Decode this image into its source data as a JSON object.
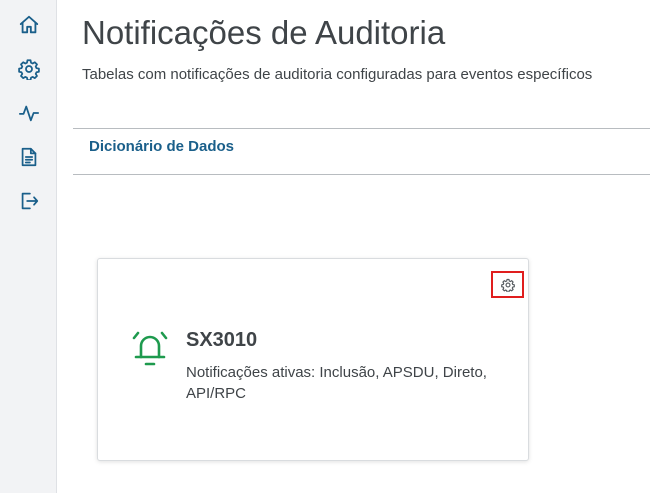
{
  "sidebar": {
    "items": [
      {
        "icon": "home-icon"
      },
      {
        "icon": "gear-icon"
      },
      {
        "icon": "activity-icon"
      },
      {
        "icon": "document-icon"
      },
      {
        "icon": "logout-icon"
      }
    ],
    "icon_color": "#1a5f8a"
  },
  "header": {
    "title": "Notificações de Auditoria",
    "subtitle": "Tabelas com notificações de auditoria configuradas para eventos específicos"
  },
  "tabs": [
    {
      "label": "Dicionário de Dados"
    }
  ],
  "cards": [
    {
      "title": "SX3010",
      "description": "Notificações ativas: Inclusão, APSDU, Direto, API/RPC",
      "icon": "bell-icon",
      "icon_color": "#1e9a4e",
      "settings_icon": "gear-icon",
      "highlight_color": "#e01e1e"
    }
  ]
}
